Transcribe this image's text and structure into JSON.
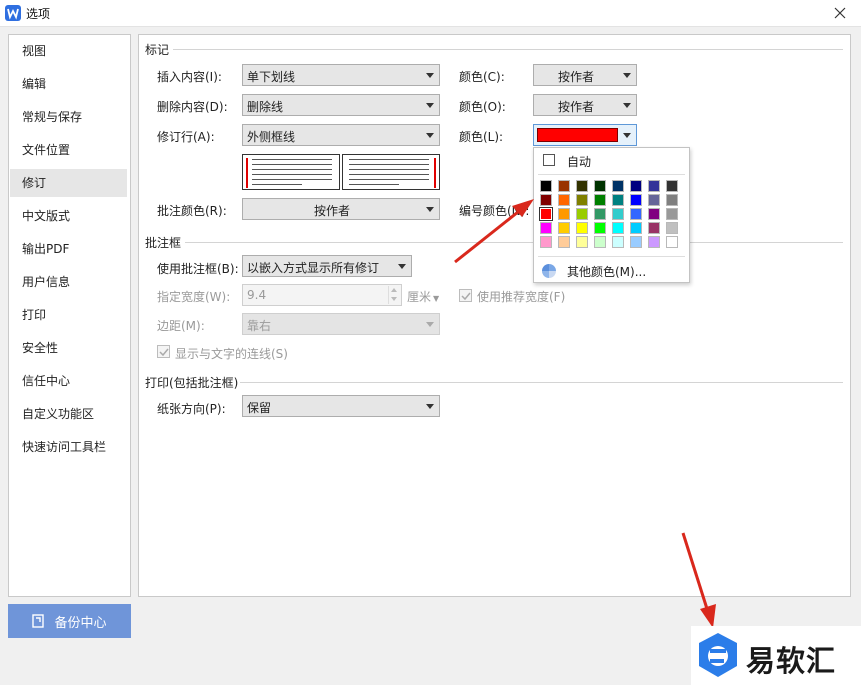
{
  "window": {
    "title": "选项"
  },
  "sidebar": {
    "items": [
      {
        "label": "视图"
      },
      {
        "label": "编辑"
      },
      {
        "label": "常规与保存"
      },
      {
        "label": "文件位置"
      },
      {
        "label": "修订"
      },
      {
        "label": "中文版式"
      },
      {
        "label": "输出PDF"
      },
      {
        "label": "用户信息"
      },
      {
        "label": "打印"
      },
      {
        "label": "安全性"
      },
      {
        "label": "信任中心"
      },
      {
        "label": "自定义功能区"
      },
      {
        "label": "快速访问工具栏"
      }
    ],
    "active_index": 4
  },
  "backup_button": {
    "label": "备份中心"
  },
  "markup": {
    "section_title": "标记",
    "insert": {
      "label": "插入内容(I):",
      "value": "单下划线",
      "color_label": "颜色(C):",
      "color_value": "按作者"
    },
    "delete": {
      "label": "删除内容(D):",
      "value": "删除线",
      "color_label": "颜色(O):",
      "color_value": "按作者"
    },
    "revised_lines": {
      "label": "修订行(A):",
      "value": "外侧框线",
      "color_label": "颜色(L):",
      "color_value": "#ff0000"
    },
    "comment_color": {
      "label": "批注颜色(R):",
      "value": "按作者"
    },
    "number_color": {
      "label": "编号颜色(N):"
    }
  },
  "balloons": {
    "section_title": "批注框",
    "use_balloons": {
      "label": "使用批注框(B):",
      "value": "以嵌入方式显示所有修订"
    },
    "width": {
      "label": "指定宽度(W):",
      "value": "9.4",
      "unit": "厘米"
    },
    "use_recommended": {
      "label": "使用推荐宽度(F)",
      "checked": true
    },
    "margin": {
      "label": "边距(M):",
      "value": "靠右"
    },
    "show_lines": {
      "label": "显示与文字的连线(S)",
      "checked": true
    }
  },
  "printing": {
    "section_title": "打印(包括批注框)",
    "paper_orientation": {
      "label": "纸张方向(P):",
      "value": "保留"
    }
  },
  "color_popup": {
    "auto_label": "自动",
    "more_label": "其他颜色(M)...",
    "selected": "#ff0000",
    "swatches": [
      [
        "#000000",
        "#993300",
        "#333300",
        "#003300",
        "#003366",
        "#000080",
        "#333399",
        "#333333"
      ],
      [
        "#800000",
        "#ff6600",
        "#808000",
        "#008000",
        "#008080",
        "#0000ff",
        "#666699",
        "#808080"
      ],
      [
        "#ff0000",
        "#ff9900",
        "#99cc00",
        "#339966",
        "#33cccc",
        "#3366ff",
        "#800080",
        "#999999"
      ],
      [
        "#ff00ff",
        "#ffcc00",
        "#ffff00",
        "#00ff00",
        "#00ffff",
        "#00ccff",
        "#993366",
        "#c0c0c0"
      ],
      [
        "#ff99cc",
        "#ffcc99",
        "#ffff99",
        "#ccffcc",
        "#ccffff",
        "#99ccff",
        "#cc99ff",
        "#ffffff"
      ]
    ]
  },
  "watermark": {
    "text": "易软汇"
  },
  "colors": {
    "accent": "#6f95d9",
    "arrow": "#d9281c"
  }
}
